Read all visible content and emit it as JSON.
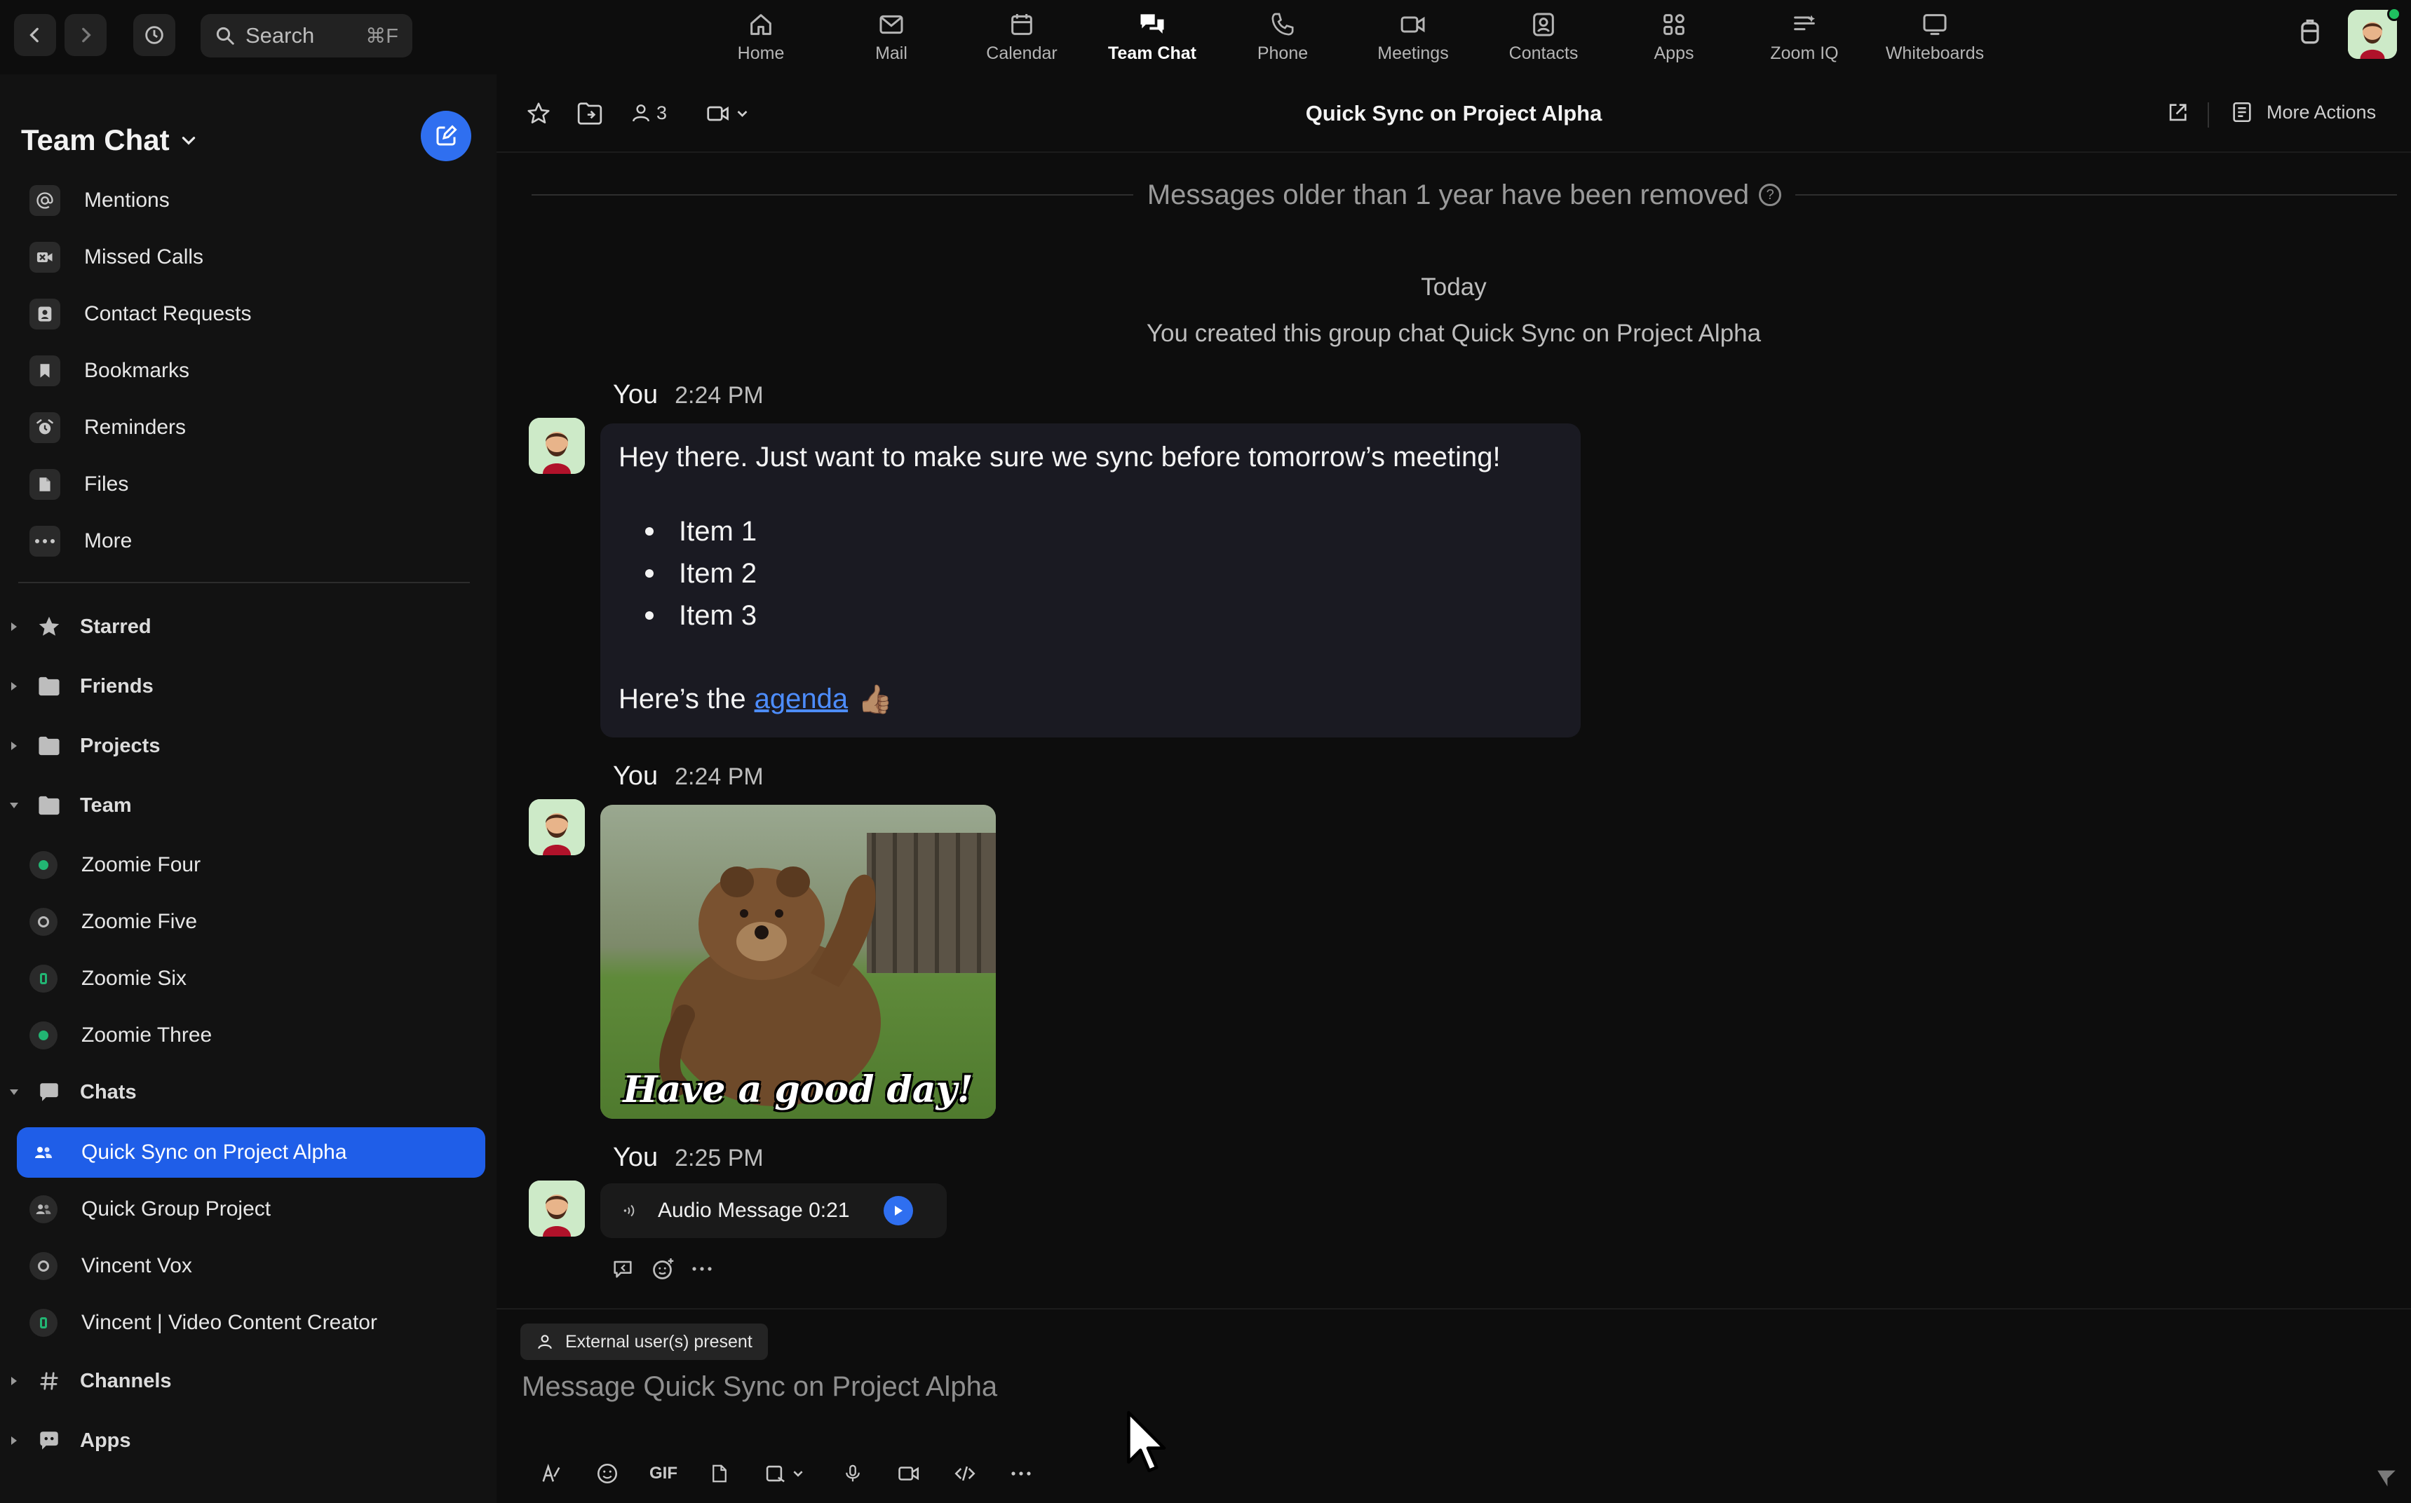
{
  "topbar": {
    "search_label": "Search",
    "search_shortcut": "⌘F",
    "tabs": [
      {
        "label": "Home",
        "icon": "home-icon"
      },
      {
        "label": "Mail",
        "icon": "mail-icon"
      },
      {
        "label": "Calendar",
        "icon": "calendar-icon"
      },
      {
        "label": "Team Chat",
        "icon": "chat-bubbles-icon",
        "active": true
      },
      {
        "label": "Phone",
        "icon": "phone-icon"
      },
      {
        "label": "Meetings",
        "icon": "video-camera-icon"
      },
      {
        "label": "Contacts",
        "icon": "contacts-icon"
      },
      {
        "label": "Apps",
        "icon": "apps-icon"
      },
      {
        "label": "Zoom IQ",
        "icon": "zoom-iq-icon"
      },
      {
        "label": "Whiteboards",
        "icon": "whiteboard-icon"
      }
    ]
  },
  "sidebar": {
    "title": "Team Chat",
    "items": [
      {
        "label": "Mentions",
        "icon": "at-icon"
      },
      {
        "label": "Missed Calls",
        "icon": "missed-call-icon"
      },
      {
        "label": "Contact Requests",
        "icon": "contact-request-icon"
      },
      {
        "label": "Bookmarks",
        "icon": "bookmark-icon"
      },
      {
        "label": "Reminders",
        "icon": "alarm-icon"
      },
      {
        "label": "Files",
        "icon": "file-icon"
      },
      {
        "label": "More",
        "icon": "more-dots-icon"
      }
    ],
    "groups": {
      "starred": "Starred",
      "friends": "Friends",
      "projects": "Projects",
      "team": "Team",
      "chats": "Chats",
      "channels": "Channels",
      "apps": "Apps"
    },
    "team_members": [
      {
        "label": "Zoomie Four",
        "status": "available"
      },
      {
        "label": "Zoomie Five",
        "status": "offline"
      },
      {
        "label": "Zoomie Six",
        "status": "mobile"
      },
      {
        "label": "Zoomie Three",
        "status": "available"
      }
    ],
    "chats": [
      {
        "label": "Quick Sync on Project Alpha",
        "selected": true
      },
      {
        "label": "Quick Group Project"
      },
      {
        "label": "Vincent Vox"
      },
      {
        "label": "Vincent | Video Content Creator"
      }
    ]
  },
  "chat": {
    "title": "Quick Sync on Project Alpha",
    "member_count": "3",
    "more_actions": "More Actions",
    "older_notice": "Messages older than 1 year have been removed",
    "day_label": "Today",
    "created_notice": "You created this group chat Quick Sync on Project Alpha",
    "messages": [
      {
        "sender": "You",
        "time": "2:24 PM",
        "line1": "Hey there. Just want to make sure we sync before tomorrow’s meeting!",
        "items": [
          "Item 1",
          "Item 2",
          "Item 3"
        ],
        "closing_prefix": "Here’s the",
        "link_text": "agenda",
        "emoji": "👍🏽"
      },
      {
        "sender": "You",
        "time": "2:24 PM",
        "gif_caption": "Have a good day!"
      },
      {
        "sender": "You",
        "time": "2:25 PM",
        "audio_label": "Audio Message 0:21"
      }
    ],
    "composer": {
      "external_badge": "External user(s) present",
      "placeholder": "Message Quick Sync on Project Alpha",
      "gif_label": "GIF"
    }
  },
  "colors": {
    "accent": "#2f6ff0",
    "selected_row": "#1f5ee8",
    "online": "#22b573",
    "link": "#4d8dff"
  }
}
